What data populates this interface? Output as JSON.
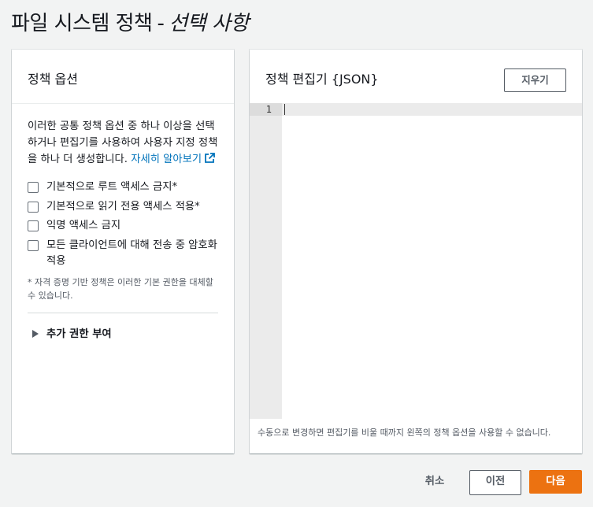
{
  "page": {
    "title_main": "파일 시스템 정책",
    "title_sep": "-",
    "title_sub": "선택 사항"
  },
  "left_panel": {
    "title": "정책 옵션",
    "description": "이러한 공통 정책 옵션 중 하나 이상을 선택하거나 편집기를 사용하여 사용자 지정 정책을 하나 더 생성합니다.",
    "learn_more_link": "자세히 알아보기",
    "options": [
      {
        "label": "기본적으로 루트 액세스 금지*",
        "checked": false
      },
      {
        "label": "기본적으로 읽기 전용 액세스 적용*",
        "checked": false
      },
      {
        "label": "익명 액세스 금지",
        "checked": false
      },
      {
        "label": "모든 클라이언트에 대해 전송 중 암호화 적용",
        "checked": false
      }
    ],
    "footnote": "* 자격 증명 기반 정책은 이러한 기본 권한을 대체할 수 있습니다.",
    "expander_label": "추가 권한 부여"
  },
  "right_panel": {
    "title": "정책 편집기 {JSON}",
    "clear_button": "지우기",
    "line_number": "1",
    "hint": "수동으로 변경하면 편집기를 비울 때까지 왼쪽의 정책 옵션을 사용할 수 없습니다."
  },
  "footer": {
    "cancel": "취소",
    "previous": "이전",
    "next": "다음"
  },
  "colors": {
    "link": "#0073bb",
    "primary_button": "#ec7211",
    "background": "#f2f3f3"
  },
  "icons": {
    "external_link": "external-link-icon",
    "expander": "caret-right-icon"
  }
}
